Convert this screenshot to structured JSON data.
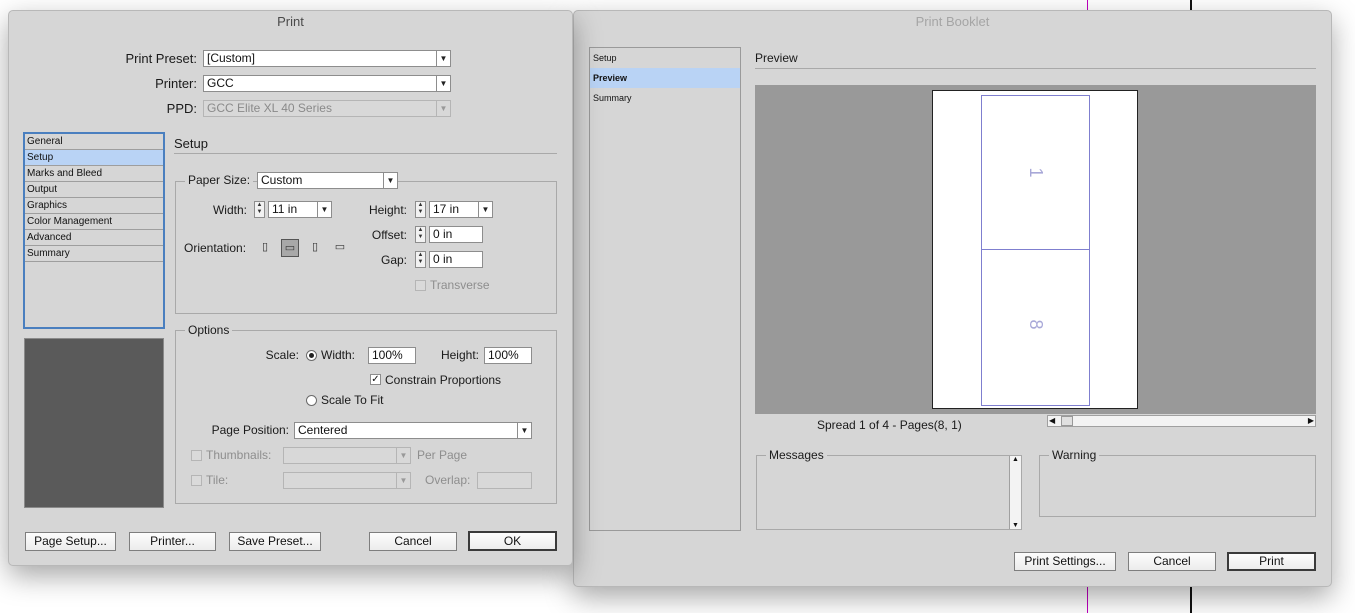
{
  "print_dialog": {
    "title": "Print",
    "print_preset": {
      "label": "Print Preset:",
      "value": "[Custom]"
    },
    "printer": {
      "label": "Printer:",
      "value": "GCC"
    },
    "ppd": {
      "label": "PPD:",
      "value": "GCC Elite XL 40 Series"
    },
    "categories": [
      {
        "label": "General",
        "selected": false
      },
      {
        "label": "Setup",
        "selected": true
      },
      {
        "label": "Marks and Bleed",
        "selected": false
      },
      {
        "label": "Output",
        "selected": false
      },
      {
        "label": "Graphics",
        "selected": false
      },
      {
        "label": "Color Management",
        "selected": false
      },
      {
        "label": "Advanced",
        "selected": false
      },
      {
        "label": "Summary",
        "selected": false
      }
    ],
    "section_title": "Setup",
    "paper": {
      "paper_size_label": "Paper Size:",
      "paper_size_value": "Custom",
      "width_label": "Width:",
      "width_value": "11 in",
      "height_label": "Height:",
      "height_value": "17 in",
      "offset_label": "Offset:",
      "offset_value": "0 in",
      "gap_label": "Gap:",
      "gap_value": "0 in",
      "orientation_label": "Orientation:",
      "orientations": [
        "portrait-icon",
        "landscape-icon",
        "reverse-portrait-icon",
        "reverse-landscape-icon"
      ],
      "orientation_selected": "landscape-icon",
      "transverse_label": "Transverse",
      "transverse_checked": false
    },
    "options": {
      "group_title": "Options",
      "scale_label": "Scale:",
      "width_label": "Width:",
      "width_value": "100%",
      "height_label": "Height:",
      "height_value": "100%",
      "scale_mode": "width",
      "constrain_label": "Constrain Proportions",
      "constrain_checked": true,
      "scale_to_fit_label": "Scale To Fit",
      "page_position_label": "Page Position:",
      "page_position_value": "Centered",
      "thumbnails_label": "Thumbnails:",
      "per_page_label": "Per Page",
      "tile_label": "Tile:",
      "overlap_label": "Overlap:"
    },
    "buttons": {
      "page_setup": "Page Setup...",
      "printer": "Printer...",
      "save_preset": "Save Preset...",
      "cancel": "Cancel",
      "ok": "OK"
    }
  },
  "booklet_dialog": {
    "title": "Print Booklet",
    "nav": [
      {
        "label": "Setup",
        "selected": false
      },
      {
        "label": "Preview",
        "selected": true
      },
      {
        "label": "Summary",
        "selected": false
      }
    ],
    "preview_title": "Preview",
    "pages": [
      "1",
      "8"
    ],
    "spread_info": "Spread 1 of 4 - Pages(8, 1)",
    "messages_label": "Messages",
    "warning_label": "Warning",
    "buttons": {
      "print_settings": "Print Settings...",
      "cancel": "Cancel",
      "print": "Print"
    }
  },
  "colors": {
    "dialog_bg": "#d6d6d6",
    "selection": "#b9d3f5",
    "listbox_border": "#4a7fbf",
    "preview_bg": "#999999",
    "page_outline": "#7f7fcf",
    "page_number": "#a8a8d8",
    "guide_line": "#c000c0"
  }
}
